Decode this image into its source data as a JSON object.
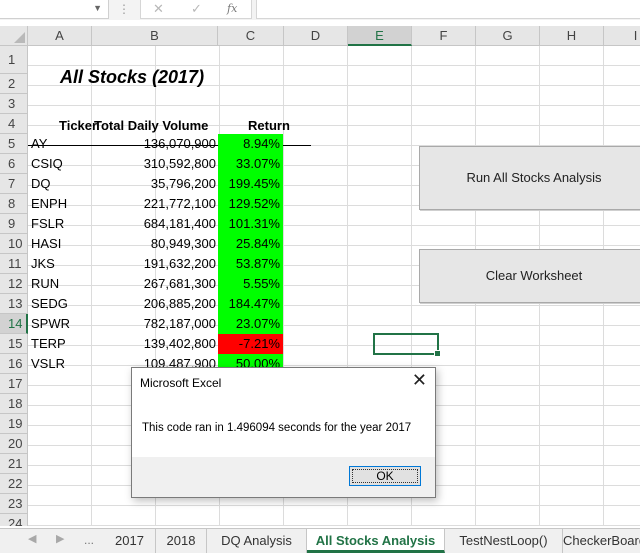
{
  "formula_bar": {
    "name_box": "",
    "cancel_icon": "✕",
    "enter_icon": "✓",
    "fx_label": "fx",
    "formula": ""
  },
  "columns": [
    "A",
    "B",
    "C",
    "D",
    "E",
    "F",
    "G",
    "H",
    "I"
  ],
  "rows": [
    "1",
    "2",
    "3",
    "4",
    "5",
    "6",
    "7",
    "8",
    "9",
    "10",
    "11",
    "12",
    "13",
    "14",
    "15",
    "16",
    "17",
    "18",
    "19",
    "20",
    "21",
    "22",
    "23",
    "24"
  ],
  "sheet": {
    "title": "All Stocks (2017)",
    "headers": {
      "ticker": "Ticker",
      "volume": "Total Daily Volume",
      "return": "Return"
    },
    "stocks": [
      {
        "ticker": "AY",
        "volume": "136,070,900",
        "return": "8.94%",
        "positive": true
      },
      {
        "ticker": "CSIQ",
        "volume": "310,592,800",
        "return": "33.07%",
        "positive": true
      },
      {
        "ticker": "DQ",
        "volume": "35,796,200",
        "return": "199.45%",
        "positive": true
      },
      {
        "ticker": "ENPH",
        "volume": "221,772,100",
        "return": "129.52%",
        "positive": true
      },
      {
        "ticker": "FSLR",
        "volume": "684,181,400",
        "return": "101.31%",
        "positive": true
      },
      {
        "ticker": "HASI",
        "volume": "80,949,300",
        "return": "25.84%",
        "positive": true
      },
      {
        "ticker": "JKS",
        "volume": "191,632,200",
        "return": "53.87%",
        "positive": true
      },
      {
        "ticker": "RUN",
        "volume": "267,681,300",
        "return": "5.55%",
        "positive": true
      },
      {
        "ticker": "SEDG",
        "volume": "206,885,200",
        "return": "184.47%",
        "positive": true
      },
      {
        "ticker": "SPWR",
        "volume": "782,187,000",
        "return": "23.07%",
        "positive": true
      },
      {
        "ticker": "TERP",
        "volume": "139,402,800",
        "return": "-7.21%",
        "positive": false
      },
      {
        "ticker": "VSLR",
        "volume": "109,487,900",
        "return": "50.00%",
        "positive": true
      }
    ]
  },
  "selected_cell": "E14",
  "buttons": {
    "run_analysis": "Run All Stocks Analysis",
    "clear_worksheet": "Clear Worksheet"
  },
  "dialog": {
    "title": "Microsoft Excel",
    "close_icon": "✕",
    "message": "This code ran in 1.496094 seconds for the year 2017",
    "ok_label": "OK"
  },
  "tabs": {
    "nav_prev_icon": "◀",
    "nav_next_icon": "▶",
    "ellipsis": "...",
    "items": [
      {
        "label": "2017",
        "active": false
      },
      {
        "label": "2018",
        "active": false
      },
      {
        "label": "DQ Analysis",
        "active": false
      },
      {
        "label": "All Stocks Analysis",
        "active": true
      },
      {
        "label": "TestNestLoop()",
        "active": false
      },
      {
        "label": "CheckerBoard",
        "active": false
      }
    ]
  },
  "colors": {
    "positive": "#00ff00",
    "negative": "#ff0000",
    "accent": "#217346"
  }
}
